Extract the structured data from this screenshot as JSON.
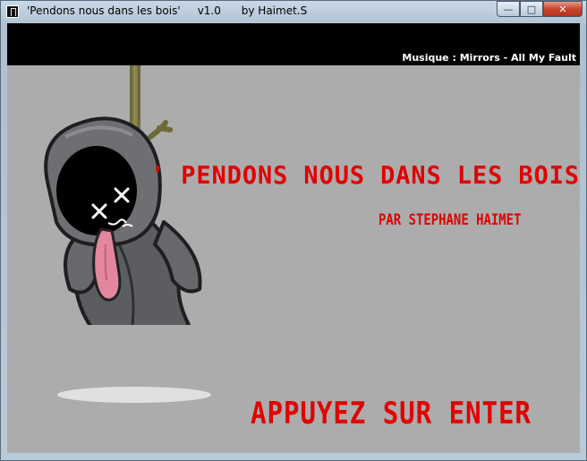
{
  "window": {
    "title": "'Pendons nous dans les bois'     v1.0      by Haimet.S",
    "controls": {
      "minimize": "—",
      "maximize": "□",
      "close": "✕"
    }
  },
  "game": {
    "music": "Musique : Mirrors - All My Fault",
    "title": "' PENDONS NOUS DANS LES BOIS '",
    "subtitle": "PAR STEPHANE HAIMET",
    "prompt": "APPUYEZ SUR ENTER",
    "colors": {
      "text_red": "#e00000",
      "background": "#acacac",
      "header": "#000000"
    },
    "sprite": "hanged-reaper"
  }
}
